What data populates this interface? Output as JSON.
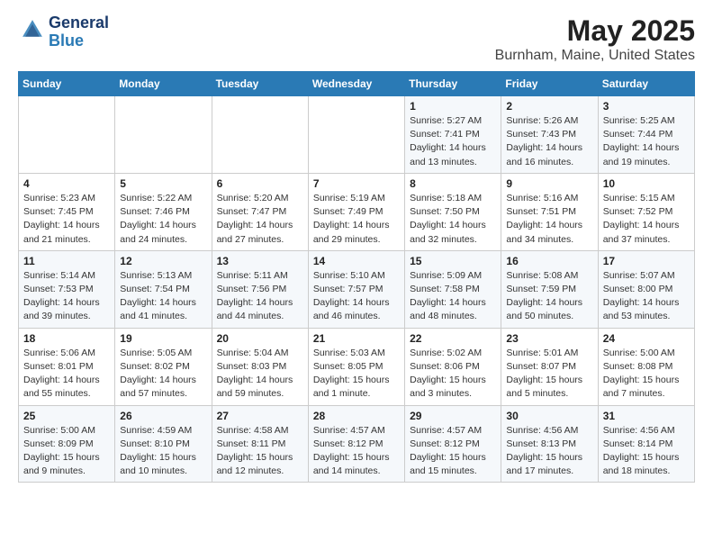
{
  "header": {
    "logo_line1": "General",
    "logo_line2": "Blue",
    "title": "May 2025",
    "subtitle": "Burnham, Maine, United States"
  },
  "days_of_week": [
    "Sunday",
    "Monday",
    "Tuesday",
    "Wednesday",
    "Thursday",
    "Friday",
    "Saturday"
  ],
  "weeks": [
    [
      {
        "num": "",
        "info": ""
      },
      {
        "num": "",
        "info": ""
      },
      {
        "num": "",
        "info": ""
      },
      {
        "num": "",
        "info": ""
      },
      {
        "num": "1",
        "info": "Sunrise: 5:27 AM\nSunset: 7:41 PM\nDaylight: 14 hours\nand 13 minutes."
      },
      {
        "num": "2",
        "info": "Sunrise: 5:26 AM\nSunset: 7:43 PM\nDaylight: 14 hours\nand 16 minutes."
      },
      {
        "num": "3",
        "info": "Sunrise: 5:25 AM\nSunset: 7:44 PM\nDaylight: 14 hours\nand 19 minutes."
      }
    ],
    [
      {
        "num": "4",
        "info": "Sunrise: 5:23 AM\nSunset: 7:45 PM\nDaylight: 14 hours\nand 21 minutes."
      },
      {
        "num": "5",
        "info": "Sunrise: 5:22 AM\nSunset: 7:46 PM\nDaylight: 14 hours\nand 24 minutes."
      },
      {
        "num": "6",
        "info": "Sunrise: 5:20 AM\nSunset: 7:47 PM\nDaylight: 14 hours\nand 27 minutes."
      },
      {
        "num": "7",
        "info": "Sunrise: 5:19 AM\nSunset: 7:49 PM\nDaylight: 14 hours\nand 29 minutes."
      },
      {
        "num": "8",
        "info": "Sunrise: 5:18 AM\nSunset: 7:50 PM\nDaylight: 14 hours\nand 32 minutes."
      },
      {
        "num": "9",
        "info": "Sunrise: 5:16 AM\nSunset: 7:51 PM\nDaylight: 14 hours\nand 34 minutes."
      },
      {
        "num": "10",
        "info": "Sunrise: 5:15 AM\nSunset: 7:52 PM\nDaylight: 14 hours\nand 37 minutes."
      }
    ],
    [
      {
        "num": "11",
        "info": "Sunrise: 5:14 AM\nSunset: 7:53 PM\nDaylight: 14 hours\nand 39 minutes."
      },
      {
        "num": "12",
        "info": "Sunrise: 5:13 AM\nSunset: 7:54 PM\nDaylight: 14 hours\nand 41 minutes."
      },
      {
        "num": "13",
        "info": "Sunrise: 5:11 AM\nSunset: 7:56 PM\nDaylight: 14 hours\nand 44 minutes."
      },
      {
        "num": "14",
        "info": "Sunrise: 5:10 AM\nSunset: 7:57 PM\nDaylight: 14 hours\nand 46 minutes."
      },
      {
        "num": "15",
        "info": "Sunrise: 5:09 AM\nSunset: 7:58 PM\nDaylight: 14 hours\nand 48 minutes."
      },
      {
        "num": "16",
        "info": "Sunrise: 5:08 AM\nSunset: 7:59 PM\nDaylight: 14 hours\nand 50 minutes."
      },
      {
        "num": "17",
        "info": "Sunrise: 5:07 AM\nSunset: 8:00 PM\nDaylight: 14 hours\nand 53 minutes."
      }
    ],
    [
      {
        "num": "18",
        "info": "Sunrise: 5:06 AM\nSunset: 8:01 PM\nDaylight: 14 hours\nand 55 minutes."
      },
      {
        "num": "19",
        "info": "Sunrise: 5:05 AM\nSunset: 8:02 PM\nDaylight: 14 hours\nand 57 minutes."
      },
      {
        "num": "20",
        "info": "Sunrise: 5:04 AM\nSunset: 8:03 PM\nDaylight: 14 hours\nand 59 minutes."
      },
      {
        "num": "21",
        "info": "Sunrise: 5:03 AM\nSunset: 8:05 PM\nDaylight: 15 hours\nand 1 minute."
      },
      {
        "num": "22",
        "info": "Sunrise: 5:02 AM\nSunset: 8:06 PM\nDaylight: 15 hours\nand 3 minutes."
      },
      {
        "num": "23",
        "info": "Sunrise: 5:01 AM\nSunset: 8:07 PM\nDaylight: 15 hours\nand 5 minutes."
      },
      {
        "num": "24",
        "info": "Sunrise: 5:00 AM\nSunset: 8:08 PM\nDaylight: 15 hours\nand 7 minutes."
      }
    ],
    [
      {
        "num": "25",
        "info": "Sunrise: 5:00 AM\nSunset: 8:09 PM\nDaylight: 15 hours\nand 9 minutes."
      },
      {
        "num": "26",
        "info": "Sunrise: 4:59 AM\nSunset: 8:10 PM\nDaylight: 15 hours\nand 10 minutes."
      },
      {
        "num": "27",
        "info": "Sunrise: 4:58 AM\nSunset: 8:11 PM\nDaylight: 15 hours\nand 12 minutes."
      },
      {
        "num": "28",
        "info": "Sunrise: 4:57 AM\nSunset: 8:12 PM\nDaylight: 15 hours\nand 14 minutes."
      },
      {
        "num": "29",
        "info": "Sunrise: 4:57 AM\nSunset: 8:12 PM\nDaylight: 15 hours\nand 15 minutes."
      },
      {
        "num": "30",
        "info": "Sunrise: 4:56 AM\nSunset: 8:13 PM\nDaylight: 15 hours\nand 17 minutes."
      },
      {
        "num": "31",
        "info": "Sunrise: 4:56 AM\nSunset: 8:14 PM\nDaylight: 15 hours\nand 18 minutes."
      }
    ]
  ]
}
